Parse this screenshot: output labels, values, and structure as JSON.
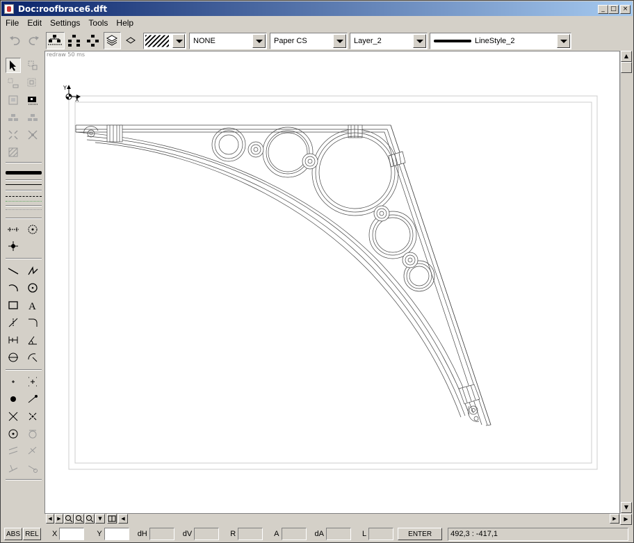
{
  "window": {
    "title": "Doc:roofbrace6.dft",
    "min": "_",
    "max": "□",
    "close": "×"
  },
  "menu": [
    "File",
    "Edit",
    "Settings",
    "Tools",
    "Help"
  ],
  "toolbar": {
    "hatch_combo": "",
    "fill_value": "NONE",
    "cs_value": "Paper CS",
    "layer_value": "Layer_2",
    "linestyle_value": "LineStyle_2"
  },
  "canvas": {
    "redraw_text": "redraw 50 ms",
    "axis_y": "Y",
    "axis_x": "X"
  },
  "status": {
    "abs": "ABS",
    "rel": "REL",
    "x_label": "X",
    "y_label": "Y",
    "dh_label": "dH",
    "dv_label": "dV",
    "r_label": "R",
    "a_label": "A",
    "da_label": "dA",
    "l_label": "L",
    "enter": "ENTER",
    "coords": "492,3 : -417,1"
  }
}
